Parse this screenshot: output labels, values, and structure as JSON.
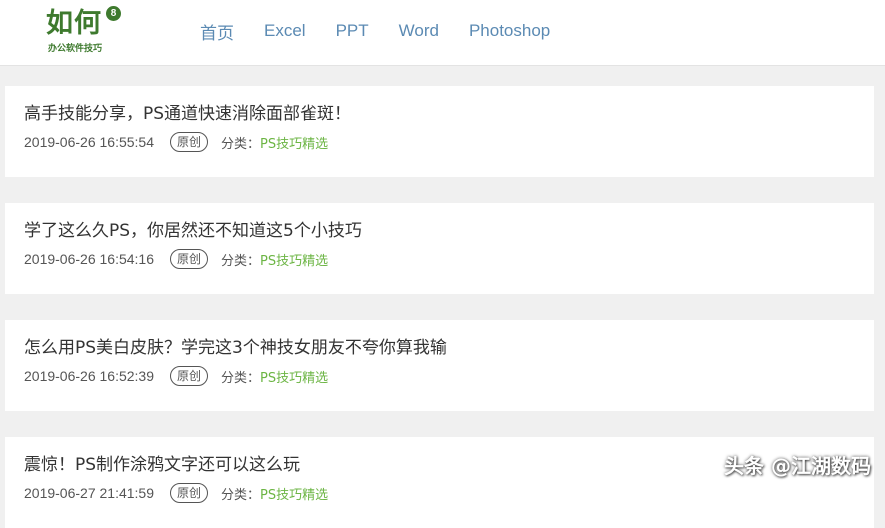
{
  "header": {
    "logo": {
      "main": "如何",
      "badge": "8",
      "sub": "办公软件技巧"
    },
    "nav": [
      "首页",
      "Excel",
      "PPT",
      "Word",
      "Photoshop"
    ]
  },
  "articles": [
    {
      "title": "高手技能分享，PS通道快速消除面部雀斑！",
      "date": "2019-06-26 16:55:54",
      "badge": "原创",
      "category_label": "分类：",
      "category": "PS技巧精选"
    },
    {
      "title": "学了这么久PS，你居然还不知道这5个小技巧",
      "date": "2019-06-26 16:54:16",
      "badge": "原创",
      "category_label": "分类：",
      "category": "PS技巧精选"
    },
    {
      "title": "怎么用PS美白皮肤？学完这3个神技女朋友不夸你算我输",
      "date": "2019-06-26 16:52:39",
      "badge": "原创",
      "category_label": "分类：",
      "category": "PS技巧精选"
    },
    {
      "title": "震惊！PS制作涂鸦文字还可以这么玩",
      "date": "2019-06-27 21:41:59",
      "badge": "原创",
      "category_label": "分类：",
      "category": "PS技巧精选"
    }
  ],
  "watermark": "头条 @江湖数码",
  "colors": {
    "brand": "#3e7a2e",
    "nav": "#5b8ab3",
    "category": "#6cb544"
  }
}
